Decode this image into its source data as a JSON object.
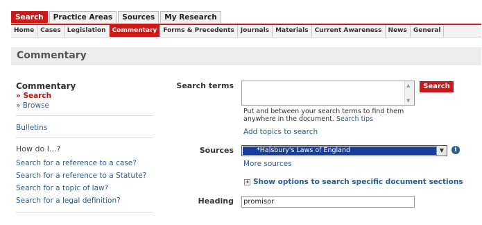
{
  "top_tabs": [
    "Search",
    "Practice Areas",
    "Sources",
    "My Research"
  ],
  "sub_nav": [
    "Home",
    "Cases",
    "Legislation",
    "Commentary",
    "Forms & Precedents",
    "Journals",
    "Materials",
    "Current Awareness",
    "News",
    "General"
  ],
  "page_title": "Commentary",
  "sidebar": {
    "title": "Commentary",
    "search_link": "» Search",
    "browse_link": "» Browse",
    "bulletins": "Bulletins",
    "how_do_i": "How do I...?",
    "help_links": [
      "Search for a reference to a case?",
      "Search for a reference to a Statute?",
      "Search for a topic of law?",
      "Search for a legal definition?"
    ]
  },
  "search_form": {
    "search_terms_label": "Search terms",
    "search_terms_value": "",
    "search_button": "Search",
    "help_text_line1": "Put and between your search terms to find them",
    "help_text_line2": "anywhere in the document.",
    "search_tips": "Search tips",
    "add_topics": "Add topics to search",
    "sources_label": "Sources",
    "sources_selected": "*Halsbury's Laws of England",
    "more_sources": "More sources",
    "show_options": "Show options to search specific document sections",
    "heading_label": "Heading",
    "heading_value": "promisor"
  },
  "colors": {
    "accent": "#cc1a1a",
    "link": "#2a5d8f",
    "selection": "#1a3d9c"
  }
}
